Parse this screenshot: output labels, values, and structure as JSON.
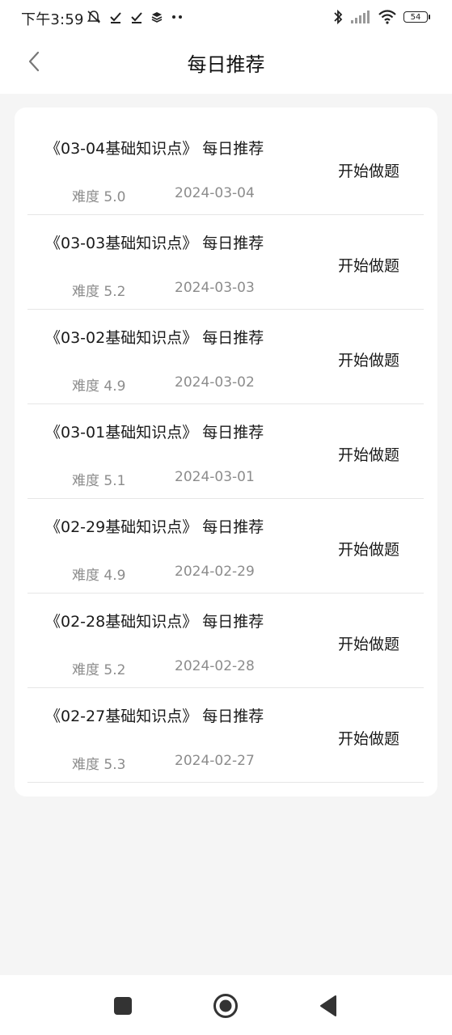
{
  "status_bar": {
    "time": "下午3:59",
    "battery": "54"
  },
  "header": {
    "title": "每日推荐"
  },
  "items": [
    {
      "title": "《03-04基础知识点》 每日推荐",
      "difficulty": "难度 5.0",
      "date": "2024-03-04",
      "action": "开始做题"
    },
    {
      "title": "《03-03基础知识点》 每日推荐",
      "difficulty": "难度 5.2",
      "date": "2024-03-03",
      "action": "开始做题"
    },
    {
      "title": "《03-02基础知识点》 每日推荐",
      "difficulty": "难度 4.9",
      "date": "2024-03-02",
      "action": "开始做题"
    },
    {
      "title": "《03-01基础知识点》 每日推荐",
      "difficulty": "难度 5.1",
      "date": "2024-03-01",
      "action": "开始做题"
    },
    {
      "title": "《02-29基础知识点》 每日推荐",
      "difficulty": "难度 4.9",
      "date": "2024-02-29",
      "action": "开始做题"
    },
    {
      "title": "《02-28基础知识点》 每日推荐",
      "difficulty": "难度 5.2",
      "date": "2024-02-28",
      "action": "开始做题"
    },
    {
      "title": "《02-27基础知识点》 每日推荐",
      "difficulty": "难度 5.3",
      "date": "2024-02-27",
      "action": "开始做题"
    }
  ],
  "icons": {
    "back": "chevron-left-icon",
    "nav_recents": "square-icon",
    "nav_home": "circle-icon",
    "nav_back": "triangle-back-icon"
  },
  "colors": {
    "background": "#f5f5f5",
    "card": "#ffffff",
    "secondary_text": "#8c8c8c",
    "divider": "#e6e6e6"
  }
}
